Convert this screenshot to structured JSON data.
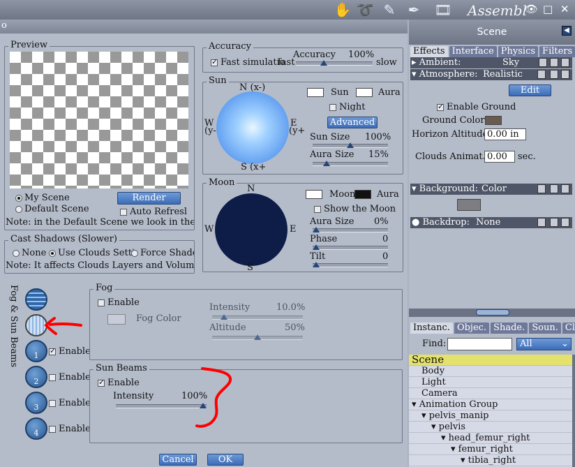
{
  "app": {
    "title": "Assembl",
    "tools": [
      "hand-icon",
      "spiral-icon",
      "brush-icon",
      "pen-icon",
      "film-icon"
    ],
    "window_buttons": {
      "eye": "👁",
      "maximize": "□",
      "close": "✕"
    }
  },
  "dialog": {
    "title_glyph": "o",
    "preview": {
      "label": "Preview",
      "scene_options": [
        "My Scene",
        "Default Scene"
      ],
      "selected_scene": "My Scene",
      "render_label": "Render",
      "auto_refresh_label": "Auto Refresl",
      "note": "Note: in the Default Scene we look in the NW"
    },
    "accuracy": {
      "label": "Accuracy",
      "fast_sim_label": "Fast simulatio",
      "slider_label": "Accuracy",
      "slider_value": "100%",
      "fast_label": "fast",
      "slow_label": "slow",
      "slider_fraction": 0.35
    },
    "sun": {
      "label": "Sun",
      "compass": {
        "n": "N (x-)",
        "s": "S (x+",
        "w": "W",
        "w2": "(y-",
        "e": "E",
        "e2": "(y+"
      },
      "sun_label": "Sun",
      "aura_label": "Aura",
      "night_label": "Night",
      "advanced_label": "Advanced",
      "sun_size_label": "Sun Size",
      "sun_size_value": "100%",
      "sun_size_fraction": 0.5,
      "aura_size_label": "Aura Size",
      "aura_size_value": "15%",
      "aura_size_fraction": 0.15
    },
    "moon": {
      "label": "Moon",
      "compass": {
        "n": "N",
        "s": "S",
        "w": "W",
        "e": "E"
      },
      "moon_label": "Moon",
      "aura_label": "Aura",
      "show_moon_label": "Show the Moon",
      "aura_size_label": "Aura Size",
      "aura_size_value": "0%",
      "phase_label": "Phase",
      "phase_value": "0",
      "tilt_label": "Tilt",
      "tilt_value": "0"
    },
    "shadows": {
      "label": "Cast Shadows (Slower)",
      "options": [
        "None",
        "Use Clouds Settin",
        "Force Shadc"
      ],
      "selected": "Use Clouds Settin",
      "note": "Note: It affects Clouds Layers and Volumetr"
    },
    "side": {
      "vertical_label": "Fog & Sun Beams",
      "layers": [
        {
          "num": "1",
          "enable": "Enable",
          "checked": true
        },
        {
          "num": "2",
          "enable": "Enable",
          "checked": false
        },
        {
          "num": "3",
          "enable": "Enable",
          "checked": false
        },
        {
          "num": "4",
          "enable": "Enable",
          "checked": false
        }
      ]
    },
    "fog": {
      "label": "Fog",
      "enable_label": "Enable",
      "color_label": "Fog Color",
      "intensity_label": "Intensity",
      "intensity_value": "10.0%",
      "intensity_fraction": 0.1,
      "altitude_label": "Altitude",
      "altitude_value": "50%",
      "altitude_fraction": 0.5
    },
    "sunbeams": {
      "label": "Sun Beams",
      "enable_label": "Enable",
      "intensity_label": "Intensity",
      "intensity_value": "100%",
      "intensity_fraction": 1.0
    },
    "cancel_label": "Cancel",
    "ok_label": "OK"
  },
  "scene_panel": {
    "title": "Scene",
    "tabs": [
      "Effects",
      "Interface",
      "Physics",
      "Filters"
    ],
    "active_tab": "Effects",
    "ambient": {
      "label": "Ambient:",
      "value": "Sky"
    },
    "atmosphere": {
      "label": "Atmosphere:",
      "value": "Realistic"
    },
    "edit_label": "Edit",
    "enable_ground_label": "Enable Ground",
    "ground_color_label": "Ground Color",
    "horizon_label": "Horizon Altitude",
    "horizon_value": "0.00 in",
    "clouds_label": "Clouds Animat.",
    "clouds_value": "0.00",
    "clouds_unit": "sec.",
    "background": {
      "label": "Background:",
      "value": "Color"
    },
    "backdrop": {
      "label": "Backdrop:",
      "value": "None"
    }
  },
  "tree_panel": {
    "tabs": [
      "Instanc.",
      "Objec.",
      "Shade.",
      "Soun.",
      "Clip."
    ],
    "find_label": "Find:",
    "find_value": "",
    "filter_value": "All",
    "items": [
      "Scene",
      "Body",
      "Light",
      "Camera",
      "Animation Group",
      "pelvis_manip",
      "pelvis",
      "head_femur_right",
      "femur_right",
      "tibia_right"
    ]
  },
  "colors": {
    "accent": "#3c6cb8",
    "sun_gradient_center": "#eaf6ff",
    "sun_gradient_edge": "#3a7fe6",
    "moon": "#0e1c48",
    "annotation": "#ff0000"
  }
}
